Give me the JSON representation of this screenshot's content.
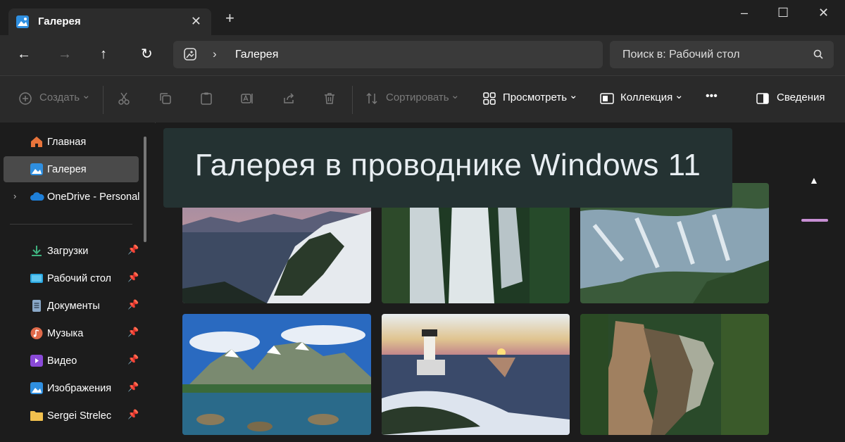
{
  "window": {
    "tab_label": "Галерея",
    "tab_close": "✕",
    "new_tab": "+",
    "minimize": "–",
    "maximize": "☐",
    "close": "✕"
  },
  "nav": {
    "back": "←",
    "forward": "→",
    "up": "↑",
    "refresh": "↻",
    "breadcrumb_chevron": "›",
    "breadcrumb": "Галерея",
    "search_placeholder": "Поиск в: Рабочий стол"
  },
  "toolbar": {
    "create": "Создать",
    "sort": "Сортировать",
    "view": "Просмотреть",
    "collection": "Коллекция",
    "more": "•••",
    "details": "Сведения",
    "chevron": "⌄"
  },
  "sidebar": {
    "items": [
      {
        "label": "Главная",
        "icon": "home-icon",
        "color": "#e8743b"
      },
      {
        "label": "Галерея",
        "icon": "gallery-icon",
        "color": "#2f8fe0"
      },
      {
        "label": "OneDrive - Personal",
        "icon": "cloud-icon",
        "color": "#1e7fd8"
      },
      {
        "label": "Загрузки",
        "icon": "download-icon",
        "color": "#3fb27f"
      },
      {
        "label": "Рабочий стол",
        "icon": "desktop-icon",
        "color": "#2aa6e0"
      },
      {
        "label": "Документы",
        "icon": "document-icon",
        "color": "#8aa8c8"
      },
      {
        "label": "Музыка",
        "icon": "music-icon",
        "color": "#e06a4a"
      },
      {
        "label": "Видео",
        "icon": "video-icon",
        "color": "#8a4ad8"
      },
      {
        "label": "Изображения",
        "icon": "pictures-icon",
        "color": "#2f8fe0"
      },
      {
        "label": "Sergei Strelec",
        "icon": "folder-icon",
        "color": "#f2c14e"
      }
    ],
    "pin": "📌",
    "expand": "›"
  },
  "banner": {
    "title": "Галерея в проводнике Windows 11"
  },
  "scroll": {
    "up": "▲"
  },
  "gallery": [
    {
      "name": "Озеро в горах зимой",
      "colors": [
        "#d88a7a",
        "#3d4a62",
        "#e6eaee"
      ]
    },
    {
      "name": "Водопад",
      "colors": [
        "#2d4a2a",
        "#c9d3d6",
        "#1f3a24"
      ]
    },
    {
      "name": "Каскад водопада",
      "colors": [
        "#2d4a3a",
        "#8aa4b4",
        "#3a5a3a"
      ]
    },
    {
      "name": "Горы у озера",
      "colors": [
        "#2a6ac0",
        "#7a8a70",
        "#2a6a8a"
      ]
    },
    {
      "name": "Маяк на закате",
      "colors": [
        "#e0c490",
        "#3a4a6a",
        "#dde4ee"
      ]
    },
    {
      "name": "Бурный водопад",
      "colors": [
        "#3a5a2a",
        "#a08060",
        "#2a4a2a"
      ]
    }
  ]
}
